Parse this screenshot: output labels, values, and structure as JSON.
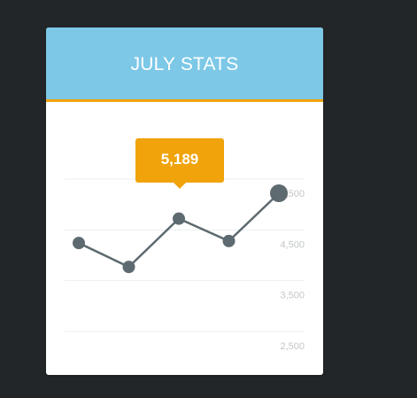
{
  "widget": {
    "title": "JULY STATS",
    "tooltip_value": "5,189"
  },
  "colors": {
    "background": "#222629",
    "header": "#7cc8e6",
    "accent": "#f0a30a",
    "line": "#5d6a6f",
    "grid": "#eceef0",
    "tick_text": "#c3c6c8"
  },
  "chart_data": {
    "type": "line",
    "y_ticks": [
      "5,500",
      "4,500",
      "3,500",
      "2,500"
    ],
    "series": [
      {
        "values": [
          4520,
          4050,
          5000,
          4560,
          5500
        ]
      }
    ],
    "ylim": [
      2500,
      5500
    ],
    "highlighted_point_index": 4,
    "grid": true
  }
}
